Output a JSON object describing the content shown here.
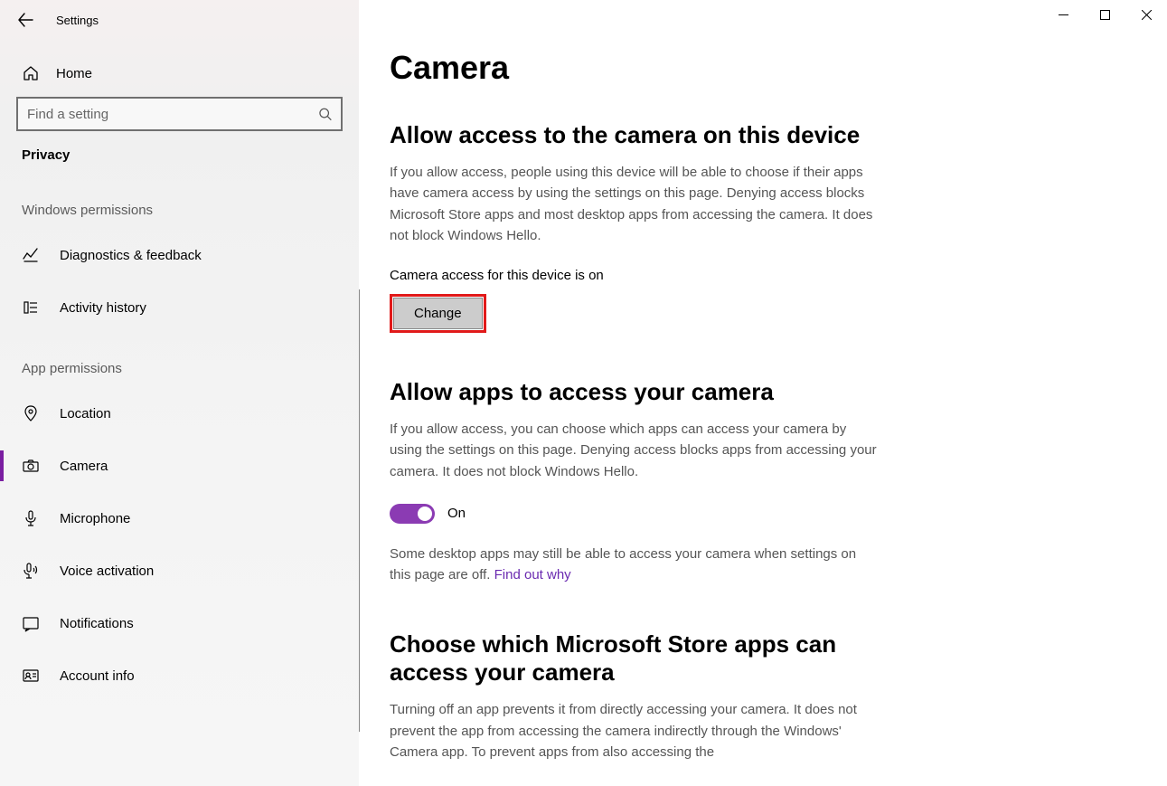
{
  "app": {
    "title": "Settings"
  },
  "sidebar": {
    "home_label": "Home",
    "search_placeholder": "Find a setting",
    "category": "Privacy",
    "sections": {
      "windows_permissions": "Windows permissions",
      "app_permissions": "App permissions"
    },
    "items": {
      "diagnostics": "Diagnostics & feedback",
      "activity_history": "Activity history",
      "location": "Location",
      "camera": "Camera",
      "microphone": "Microphone",
      "voice_activation": "Voice activation",
      "notifications": "Notifications",
      "account_info": "Account info"
    }
  },
  "main": {
    "title": "Camera",
    "section1": {
      "heading": "Allow access to the camera on this device",
      "body": "If you allow access, people using this device will be able to choose if their apps have camera access by using the settings on this page. Denying access blocks Microsoft Store apps and most desktop apps from accessing the camera. It does not block Windows Hello.",
      "status": "Camera access for this device is on",
      "change_label": "Change"
    },
    "section2": {
      "heading": "Allow apps to access your camera",
      "body": "If you allow access, you can choose which apps can access your camera by using the settings on this page. Denying access blocks apps from accessing your camera. It does not block Windows Hello.",
      "toggle_label": "On",
      "note": "Some desktop apps may still be able to access your camera when settings on this page are off. ",
      "link": "Find out why"
    },
    "section3": {
      "heading": "Choose which Microsoft Store apps can access your camera",
      "body": "Turning off an app prevents it from directly accessing your camera. It does not prevent the app from accessing the camera indirectly through the Windows' Camera app. To prevent apps from also accessing the"
    }
  }
}
